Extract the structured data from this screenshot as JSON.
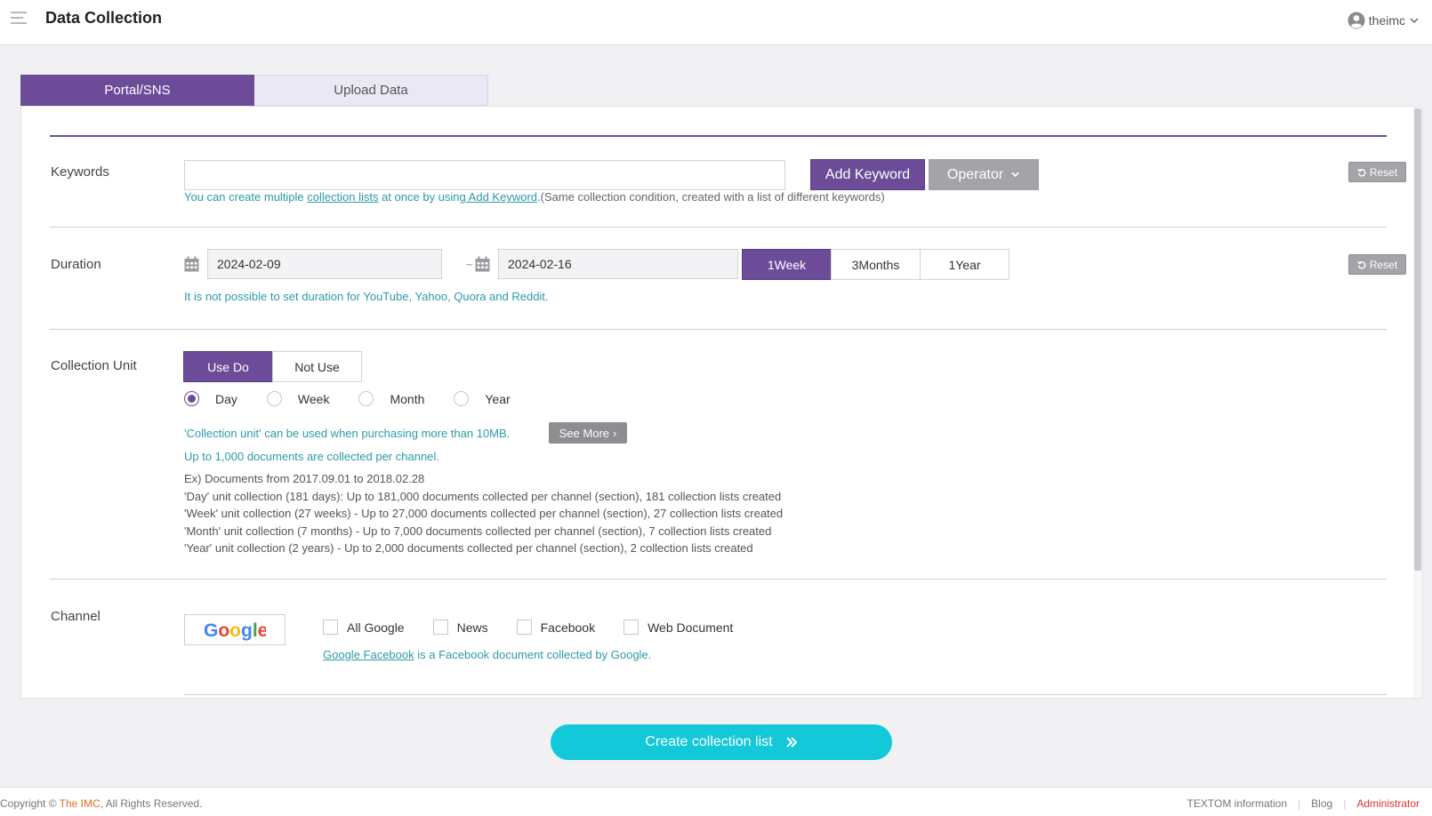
{
  "app": {
    "title": "Data Collection",
    "user": "theimc"
  },
  "tabs": [
    {
      "label": "Portal/SNS",
      "active": true
    },
    {
      "label": "Upload Data",
      "active": false
    }
  ],
  "keywords": {
    "label": "Keywords",
    "input_value": "",
    "add_button": "Add Keyword",
    "operator_button": "Operator",
    "reset": "Reset",
    "hint_pre": "You can create multiple ",
    "hint_link1": "collection lists",
    "hint_mid": " at once by using",
    "hint_link2": " Add Keyword",
    "hint_post": ".(Same collection condition, created with a list of different keywords)"
  },
  "duration": {
    "label": "Duration",
    "start": "2024-02-09",
    "end": "2024-02-16",
    "separator": "~",
    "presets": [
      "1Week",
      "3Months",
      "1Year"
    ],
    "active_preset": "1Week",
    "reset": "Reset",
    "note": "It is not possible to set duration for YouTube, Yahoo, Quora and Reddit."
  },
  "collection_unit": {
    "label": "Collection Unit",
    "toggle": [
      "Use Do",
      "Not Use"
    ],
    "toggle_active": "Use Do",
    "units": [
      "Day",
      "Week",
      "Month",
      "Year"
    ],
    "selected_unit": "Day",
    "note1": "'Collection unit' can be used when purchasing more than 10MB.",
    "see_more": "See More",
    "note2": "Up to 1,000 documents are collected per channel.",
    "examples": [
      "Ex) Documents from 2017.09.01 to 2018.02.28",
      "'Day' unit collection (181 days): Up to 181,000 documents collected per channel (section), 181 collection lists created",
      "'Week' unit collection (27 weeks) - Up to 27,000 documents collected per channel (section), 27 collection lists created",
      "'Month' unit collection (7 months) - Up to 7,000 documents collected per channel (section), 7 collection lists created",
      "'Year' unit collection (2 years) - Up to 2,000 documents collected per channel (section), 2 collection lists created"
    ]
  },
  "channel": {
    "label": "Channel",
    "provider": "Google",
    "options": [
      "All Google",
      "News",
      "Facebook",
      "Web Document"
    ],
    "note_link": "Google Facebook",
    "note_rest": " is a Facebook document collected by Google."
  },
  "create_button": "Create collection list",
  "footer": {
    "copyright_pre": "Copyright © ",
    "org": "The IMC",
    "copyright_post": ", All Rights Reserved.",
    "links": [
      "TEXTOM information",
      "Blog",
      "Administrator"
    ]
  },
  "colors": {
    "accent": "#6c4c99",
    "teal": "#2b9aa8",
    "cta": "#12c8d9",
    "admin": "#d63a2e",
    "org": "#e86a1f"
  }
}
